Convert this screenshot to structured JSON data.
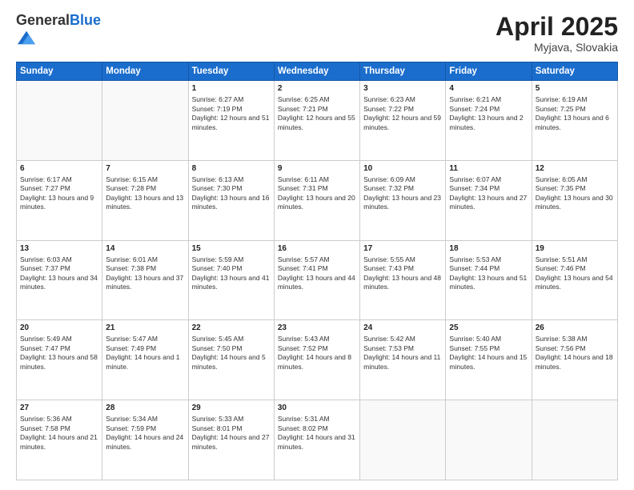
{
  "header": {
    "logo_general": "General",
    "logo_blue": "Blue",
    "title": "April 2025",
    "location": "Myjava, Slovakia"
  },
  "days_of_week": [
    "Sunday",
    "Monday",
    "Tuesday",
    "Wednesday",
    "Thursday",
    "Friday",
    "Saturday"
  ],
  "weeks": [
    [
      {
        "day": "",
        "info": ""
      },
      {
        "day": "",
        "info": ""
      },
      {
        "day": "1",
        "info": "Sunrise: 6:27 AM\nSunset: 7:19 PM\nDaylight: 12 hours and 51 minutes."
      },
      {
        "day": "2",
        "info": "Sunrise: 6:25 AM\nSunset: 7:21 PM\nDaylight: 12 hours and 55 minutes."
      },
      {
        "day": "3",
        "info": "Sunrise: 6:23 AM\nSunset: 7:22 PM\nDaylight: 12 hours and 59 minutes."
      },
      {
        "day": "4",
        "info": "Sunrise: 6:21 AM\nSunset: 7:24 PM\nDaylight: 13 hours and 2 minutes."
      },
      {
        "day": "5",
        "info": "Sunrise: 6:19 AM\nSunset: 7:25 PM\nDaylight: 13 hours and 6 minutes."
      }
    ],
    [
      {
        "day": "6",
        "info": "Sunrise: 6:17 AM\nSunset: 7:27 PM\nDaylight: 13 hours and 9 minutes."
      },
      {
        "day": "7",
        "info": "Sunrise: 6:15 AM\nSunset: 7:28 PM\nDaylight: 13 hours and 13 minutes."
      },
      {
        "day": "8",
        "info": "Sunrise: 6:13 AM\nSunset: 7:30 PM\nDaylight: 13 hours and 16 minutes."
      },
      {
        "day": "9",
        "info": "Sunrise: 6:11 AM\nSunset: 7:31 PM\nDaylight: 13 hours and 20 minutes."
      },
      {
        "day": "10",
        "info": "Sunrise: 6:09 AM\nSunset: 7:32 PM\nDaylight: 13 hours and 23 minutes."
      },
      {
        "day": "11",
        "info": "Sunrise: 6:07 AM\nSunset: 7:34 PM\nDaylight: 13 hours and 27 minutes."
      },
      {
        "day": "12",
        "info": "Sunrise: 6:05 AM\nSunset: 7:35 PM\nDaylight: 13 hours and 30 minutes."
      }
    ],
    [
      {
        "day": "13",
        "info": "Sunrise: 6:03 AM\nSunset: 7:37 PM\nDaylight: 13 hours and 34 minutes."
      },
      {
        "day": "14",
        "info": "Sunrise: 6:01 AM\nSunset: 7:38 PM\nDaylight: 13 hours and 37 minutes."
      },
      {
        "day": "15",
        "info": "Sunrise: 5:59 AM\nSunset: 7:40 PM\nDaylight: 13 hours and 41 minutes."
      },
      {
        "day": "16",
        "info": "Sunrise: 5:57 AM\nSunset: 7:41 PM\nDaylight: 13 hours and 44 minutes."
      },
      {
        "day": "17",
        "info": "Sunrise: 5:55 AM\nSunset: 7:43 PM\nDaylight: 13 hours and 48 minutes."
      },
      {
        "day": "18",
        "info": "Sunrise: 5:53 AM\nSunset: 7:44 PM\nDaylight: 13 hours and 51 minutes."
      },
      {
        "day": "19",
        "info": "Sunrise: 5:51 AM\nSunset: 7:46 PM\nDaylight: 13 hours and 54 minutes."
      }
    ],
    [
      {
        "day": "20",
        "info": "Sunrise: 5:49 AM\nSunset: 7:47 PM\nDaylight: 13 hours and 58 minutes."
      },
      {
        "day": "21",
        "info": "Sunrise: 5:47 AM\nSunset: 7:49 PM\nDaylight: 14 hours and 1 minute."
      },
      {
        "day": "22",
        "info": "Sunrise: 5:45 AM\nSunset: 7:50 PM\nDaylight: 14 hours and 5 minutes."
      },
      {
        "day": "23",
        "info": "Sunrise: 5:43 AM\nSunset: 7:52 PM\nDaylight: 14 hours and 8 minutes."
      },
      {
        "day": "24",
        "info": "Sunrise: 5:42 AM\nSunset: 7:53 PM\nDaylight: 14 hours and 11 minutes."
      },
      {
        "day": "25",
        "info": "Sunrise: 5:40 AM\nSunset: 7:55 PM\nDaylight: 14 hours and 15 minutes."
      },
      {
        "day": "26",
        "info": "Sunrise: 5:38 AM\nSunset: 7:56 PM\nDaylight: 14 hours and 18 minutes."
      }
    ],
    [
      {
        "day": "27",
        "info": "Sunrise: 5:36 AM\nSunset: 7:58 PM\nDaylight: 14 hours and 21 minutes."
      },
      {
        "day": "28",
        "info": "Sunrise: 5:34 AM\nSunset: 7:59 PM\nDaylight: 14 hours and 24 minutes."
      },
      {
        "day": "29",
        "info": "Sunrise: 5:33 AM\nSunset: 8:01 PM\nDaylight: 14 hours and 27 minutes."
      },
      {
        "day": "30",
        "info": "Sunrise: 5:31 AM\nSunset: 8:02 PM\nDaylight: 14 hours and 31 minutes."
      },
      {
        "day": "",
        "info": ""
      },
      {
        "day": "",
        "info": ""
      },
      {
        "day": "",
        "info": ""
      }
    ]
  ]
}
